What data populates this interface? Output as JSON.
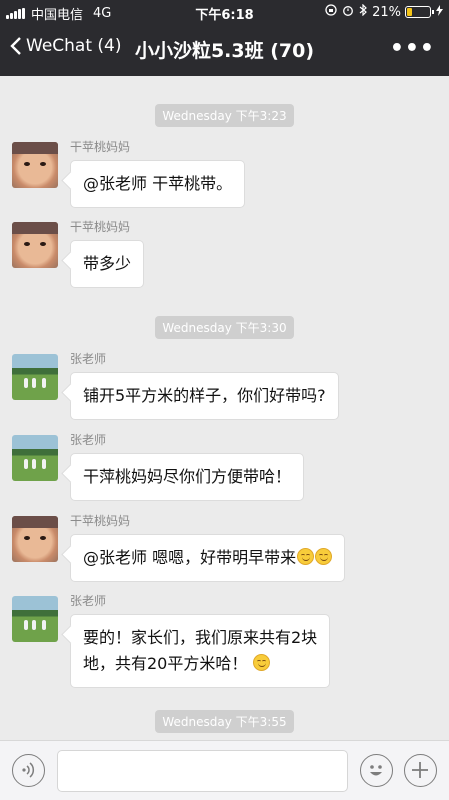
{
  "status_bar": {
    "carrier": "中国电信",
    "network": "4G",
    "time": "下午6:18",
    "battery_percent": "21%",
    "battery_level": 0.21,
    "battery_color": "#f5c518",
    "icons": [
      "signal-icon",
      "orientation-lock-icon",
      "alarm-icon",
      "bluetooth-icon",
      "battery-icon",
      "charging-icon"
    ]
  },
  "nav": {
    "back_label": "WeChat (4)",
    "title": "小小沙粒5.3班 (70)",
    "more_label": "•••"
  },
  "chat": {
    "time_separators": [
      "Wednesday 下午3:23",
      "Wednesday 下午3:30",
      "Wednesday 下午3:55"
    ],
    "messages": [
      {
        "sender": "干苹桃妈妈",
        "avatar": "baby-avatar",
        "text": "@张老师 干苹桃带。"
      },
      {
        "sender": "干苹桃妈妈",
        "avatar": "baby-avatar",
        "text": "带多少"
      },
      {
        "sender": "张老师",
        "avatar": "field-avatar",
        "text": "铺开5平方米的样子，你们好带吗?"
      },
      {
        "sender": "张老师",
        "avatar": "field-avatar",
        "text": "干萍桃妈妈尽你们方便带哈！"
      },
      {
        "sender": "干苹桃妈妈",
        "avatar": "baby-avatar",
        "text": "@张老师 嗯嗯，好带明早带来"
      },
      {
        "sender": "张老师",
        "avatar": "field-avatar",
        "line1": "要的！家长们，我们原来共有2块",
        "line2": "地，共有20平方米哈！"
      }
    ]
  },
  "input_bar": {
    "placeholder": "",
    "icons": [
      "voice-icon",
      "emoji-icon",
      "plus-icon"
    ]
  },
  "colors": {
    "header_bg": "#2b2b2f",
    "chat_bg": "#ebebeb",
    "bubble_bg": "#ffffff",
    "time_chip_bg": "#cfcfcf"
  }
}
